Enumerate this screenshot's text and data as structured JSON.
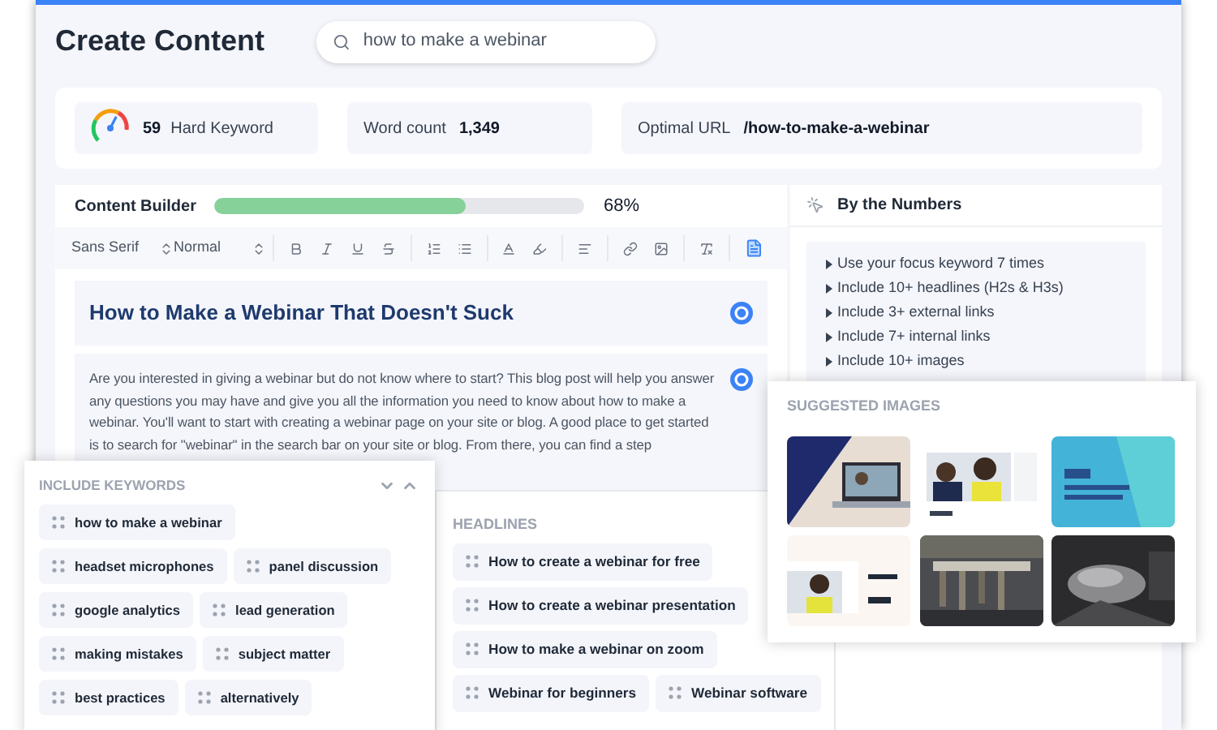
{
  "header": {
    "title": "Create Content",
    "search": {
      "value": "how to make a webinar"
    }
  },
  "stats": {
    "difficulty": {
      "score": "59",
      "label": "Hard Keyword"
    },
    "word_count": {
      "label": "Word count",
      "value": "1,349"
    },
    "url": {
      "label": "Optimal URL",
      "value": "/how-to-make-a-webinar"
    }
  },
  "builder": {
    "title": "Content Builder",
    "progress": {
      "level": 0.68,
      "reading": "68%"
    },
    "font": "Sans Serif",
    "size": "Normal",
    "heading": "How to Make a Webinar That Doesn't Suck",
    "paragraph": "Are you interested in giving a webinar but do not know where to start? This blog post will help you answer any questions you may have and give you all the information you need to know about how to make a webinar. You'll want to start with creating a webinar page on your site or blog. A good place to get started is to search for \"webinar\" in the search bar on your site or blog. From there, you can find a step"
  },
  "by_the_numbers": {
    "title": "By the Numbers",
    "items": [
      "Use your focus keyword 7 times",
      "Include 10+ headlines (H2s & H3s)",
      "Include 3+ external links",
      "Include 7+ internal links",
      "Include 10+ images"
    ]
  },
  "suggested_images": {
    "title": "SUGGESTED IMAGES"
  },
  "keywords": {
    "title": "INCLUDE KEYWORDS",
    "items": [
      "how to make a webinar",
      "headset microphones",
      "panel discussion",
      "google analytics",
      "lead generation",
      "making mistakes",
      "subject matter",
      "best practices",
      "alternatively"
    ]
  },
  "headlines": {
    "title": "HEADLINES",
    "items": [
      "How to create a webinar for free",
      "How to create a webinar presentation",
      "How to make a webinar on zoom",
      "Webinar for beginners",
      "Webinar software"
    ]
  }
}
